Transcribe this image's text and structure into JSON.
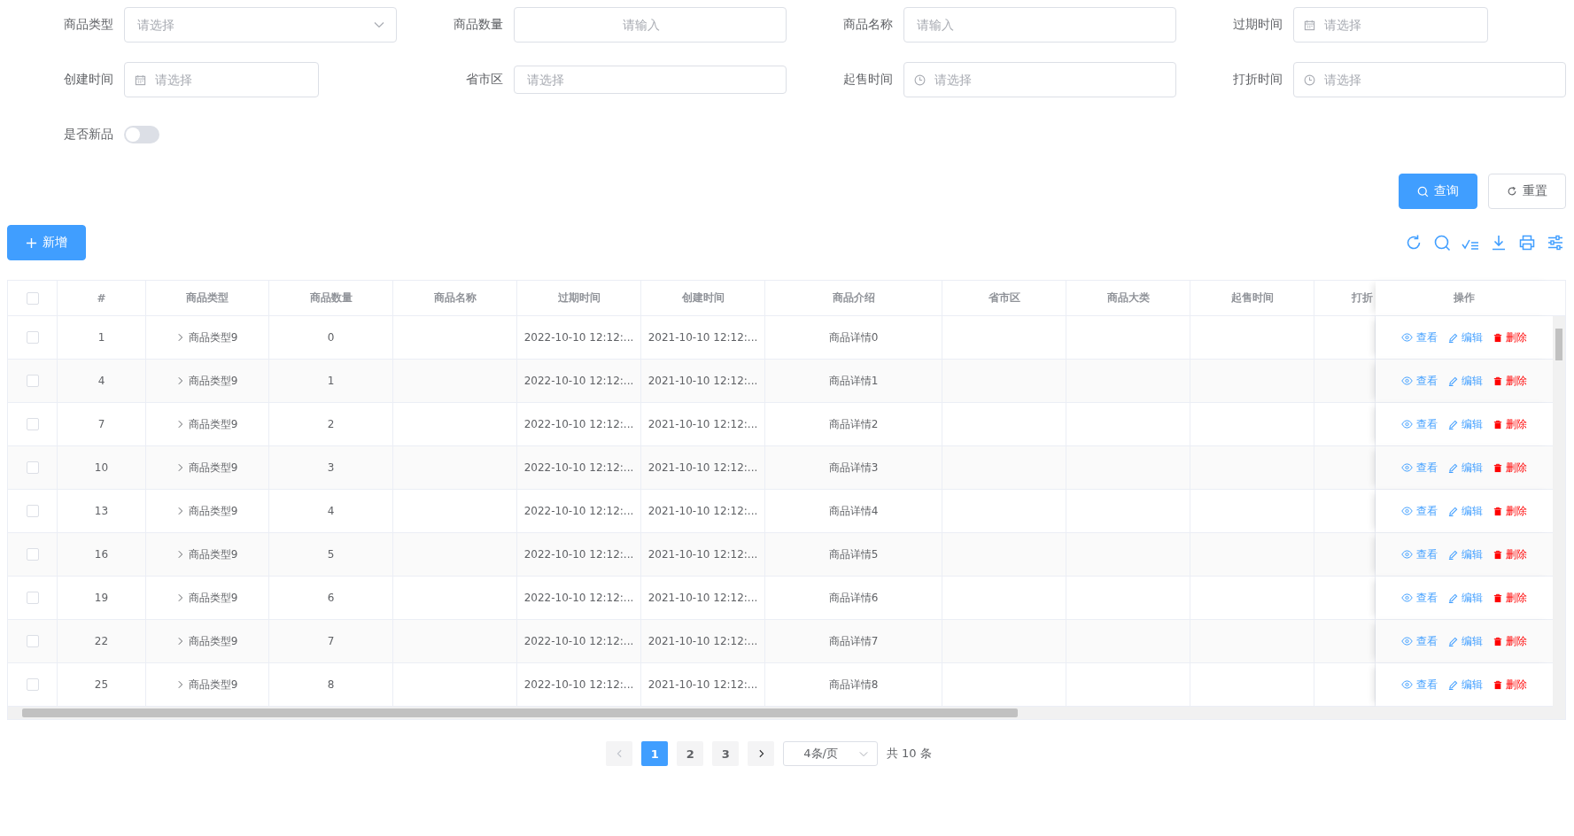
{
  "filters": [
    {
      "label": "商品类型",
      "kind": "select",
      "placeholder": "请选择"
    },
    {
      "label": "商品数量",
      "kind": "number",
      "placeholder": "请输入"
    },
    {
      "label": "商品名称",
      "kind": "input",
      "placeholder": "请输入"
    },
    {
      "label": "过期时间",
      "kind": "date",
      "placeholder": "请选择"
    },
    {
      "label": "创建时间",
      "kind": "date",
      "placeholder": "请选择"
    },
    {
      "label": "省市区",
      "kind": "region",
      "placeholder": "请选择"
    },
    {
      "label": "起售时间",
      "kind": "time",
      "placeholder": "请选择"
    },
    {
      "label": "打折时间",
      "kind": "time",
      "placeholder": "请选择"
    }
  ],
  "new_switch": {
    "label": "是否新品",
    "on": false
  },
  "search_button": "查询",
  "reset_button": "重置",
  "add_button": "新增",
  "table": {
    "header_checked": false,
    "columns": [
      "#",
      "商品类型",
      "商品数量",
      "商品名称",
      "过期时间",
      "创建时间",
      "商品介绍",
      "省市区",
      "商品大类",
      "起售时间",
      "打折",
      "操作"
    ],
    "rows": [
      {
        "checked": false,
        "expanded": false,
        "index": "1",
        "type": "商品类型9",
        "quantity": "0",
        "expire": "2022-10-10 12:12:...",
        "created": "2021-10-10 12:12:...",
        "intro": "商品详情0",
        "actions": [
          {
            "kind": "view",
            "label": "查看"
          },
          {
            "kind": "edit",
            "label": "编辑"
          },
          {
            "kind": "delete",
            "label": "删除"
          }
        ]
      },
      {
        "checked": false,
        "expanded": false,
        "index": "4",
        "type": "商品类型9",
        "quantity": "1",
        "expire": "2022-10-10 12:12:...",
        "created": "2021-10-10 12:12:...",
        "intro": "商品详情1",
        "actions": [
          {
            "kind": "view",
            "label": "查看"
          },
          {
            "kind": "edit",
            "label": "编辑"
          },
          {
            "kind": "delete",
            "label": "删除"
          }
        ]
      },
      {
        "checked": false,
        "expanded": false,
        "index": "7",
        "type": "商品类型9",
        "quantity": "2",
        "expire": "2022-10-10 12:12:...",
        "created": "2021-10-10 12:12:...",
        "intro": "商品详情2",
        "actions": [
          {
            "kind": "view",
            "label": "查看"
          },
          {
            "kind": "edit",
            "label": "编辑"
          },
          {
            "kind": "delete",
            "label": "删除"
          }
        ]
      },
      {
        "checked": false,
        "expanded": false,
        "index": "10",
        "type": "商品类型9",
        "quantity": "3",
        "expire": "2022-10-10 12:12:...",
        "created": "2021-10-10 12:12:...",
        "intro": "商品详情3",
        "actions": [
          {
            "kind": "view",
            "label": "查看"
          },
          {
            "kind": "edit",
            "label": "编辑"
          },
          {
            "kind": "delete",
            "label": "删除"
          }
        ]
      },
      {
        "checked": false,
        "expanded": false,
        "index": "13",
        "type": "商品类型9",
        "quantity": "4",
        "expire": "2022-10-10 12:12:...",
        "created": "2021-10-10 12:12:...",
        "intro": "商品详情4",
        "actions": [
          {
            "kind": "view",
            "label": "查看"
          },
          {
            "kind": "edit",
            "label": "编辑"
          },
          {
            "kind": "delete",
            "label": "删除"
          }
        ]
      },
      {
        "checked": false,
        "expanded": false,
        "index": "16",
        "type": "商品类型9",
        "quantity": "5",
        "expire": "2022-10-10 12:12:...",
        "created": "2021-10-10 12:12:...",
        "intro": "商品详情5",
        "actions": [
          {
            "kind": "view",
            "label": "查看"
          },
          {
            "kind": "edit",
            "label": "编辑"
          },
          {
            "kind": "delete",
            "label": "删除"
          }
        ]
      },
      {
        "checked": false,
        "expanded": false,
        "index": "19",
        "type": "商品类型9",
        "quantity": "6",
        "expire": "2022-10-10 12:12:...",
        "created": "2021-10-10 12:12:...",
        "intro": "商品详情6",
        "actions": [
          {
            "kind": "view",
            "label": "查看"
          },
          {
            "kind": "edit",
            "label": "编辑"
          },
          {
            "kind": "delete",
            "label": "删除"
          }
        ]
      },
      {
        "checked": false,
        "expanded": false,
        "index": "22",
        "type": "商品类型9",
        "quantity": "7",
        "expire": "2022-10-10 12:12:...",
        "created": "2021-10-10 12:12:...",
        "intro": "商品详情7",
        "actions": [
          {
            "kind": "view",
            "label": "查看"
          },
          {
            "kind": "edit",
            "label": "编辑"
          },
          {
            "kind": "delete",
            "label": "删除"
          }
        ]
      },
      {
        "checked": false,
        "expanded": false,
        "index": "25",
        "type": "商品类型9",
        "quantity": "8",
        "expire": "2022-10-10 12:12:...",
        "created": "2021-10-10 12:12:...",
        "intro": "商品详情8",
        "actions": [
          {
            "kind": "view",
            "label": "查看"
          },
          {
            "kind": "edit",
            "label": "编辑"
          },
          {
            "kind": "delete",
            "label": "删除"
          }
        ]
      }
    ]
  },
  "pagination": {
    "prev_disabled": true,
    "pages": [
      {
        "label": "1",
        "selected": true
      },
      {
        "label": "2",
        "selected": false
      },
      {
        "label": "3",
        "selected": false
      }
    ],
    "page_size": "4条/页",
    "total": "共 10 条"
  }
}
